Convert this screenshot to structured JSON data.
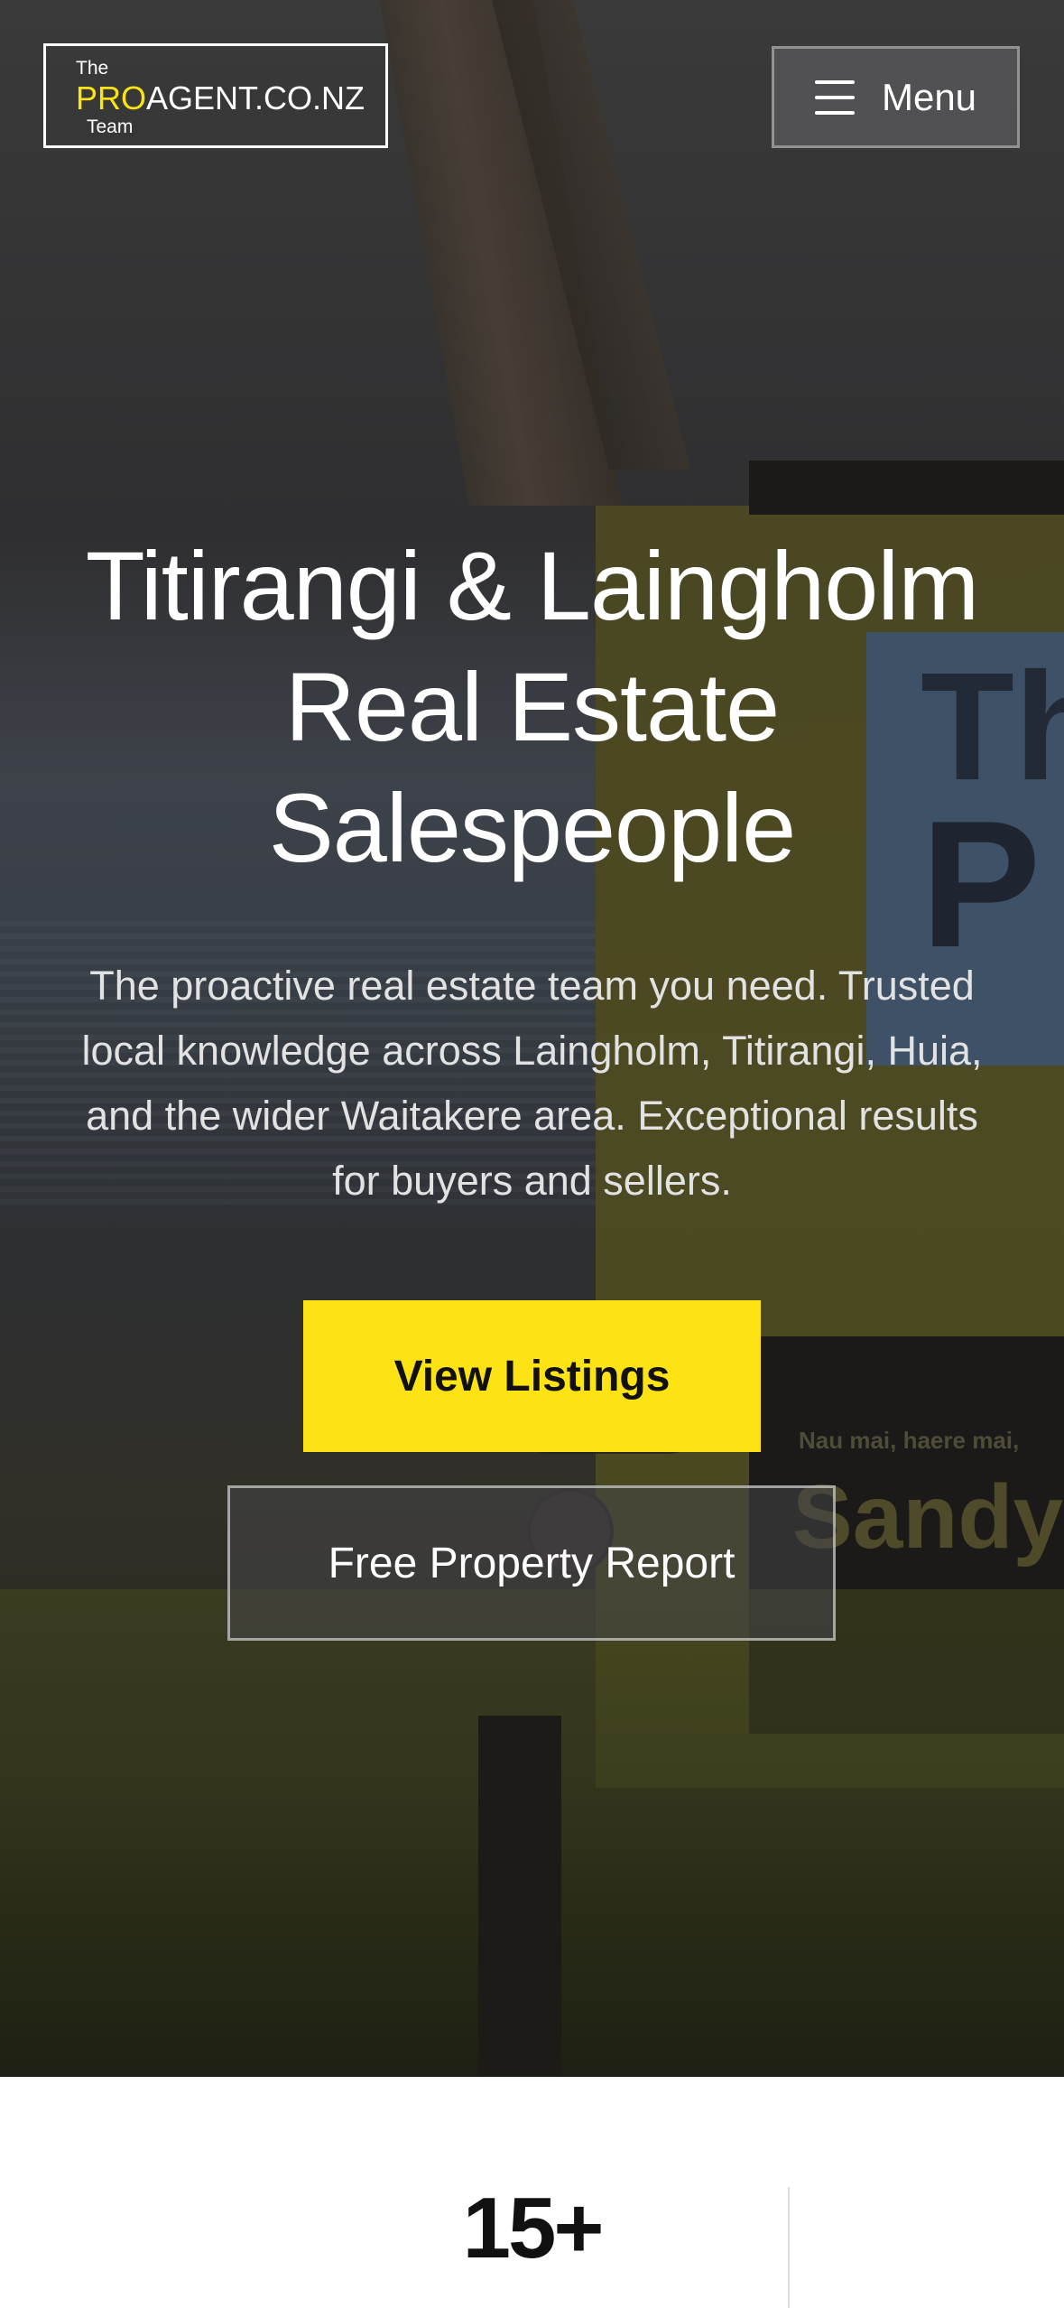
{
  "header": {
    "logo": {
      "the": "The",
      "pro": "PRO",
      "rest": "AGENT.CO.NZ",
      "team": "Team"
    },
    "menu_icon": "hamburger-icon",
    "menu_label": "Menu"
  },
  "hero": {
    "title": "Titirangi & Laingholm Real Estate Salespeople",
    "description": "The proactive real estate team you need. Trusted local knowledge across Laingholm, Titirangi, Huia, and the wider Waitakere area. Exceptional results for buyers and sellers.",
    "primary_button": "View Listings",
    "secondary_button": "Free Property Report",
    "background_sign": {
      "text_1": "Th",
      "text_2": "P",
      "greeting": "Nau mai, haere mai,",
      "name": "Sandy"
    }
  },
  "stats": {
    "value": "15+"
  },
  "colors": {
    "accent": "#fde314",
    "text_dark": "#111111",
    "text_light": "#ffffff"
  }
}
